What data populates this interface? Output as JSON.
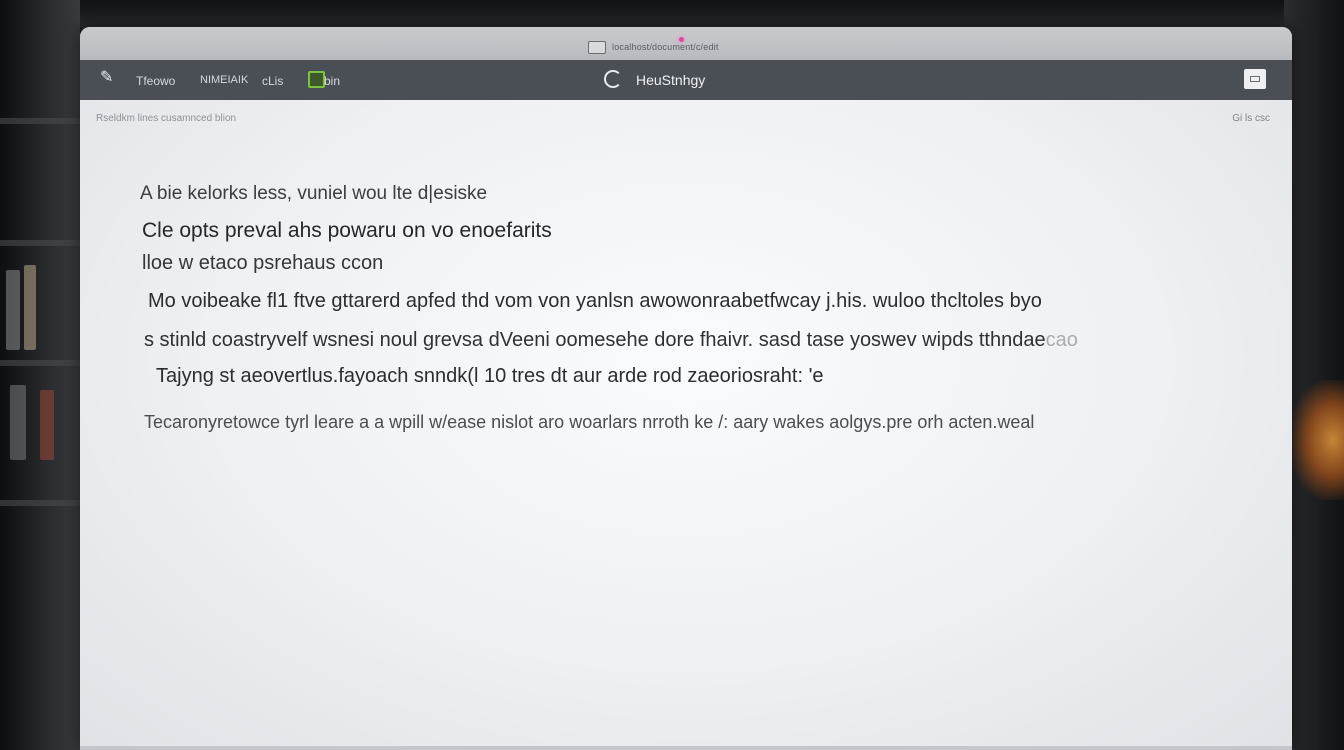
{
  "window": {
    "title": "localhost/document/c/edit"
  },
  "toolbar": {
    "items": [
      "Tfeowo",
      "NIMEIAIK",
      "cLis",
      "bin"
    ],
    "center_title": "HeuStnhgy",
    "app_icon": "pen-icon",
    "browser_icon": "edge-icon",
    "right_icon": "window-icon"
  },
  "content": {
    "breadcrumb": "Rseldkm lines cusamnced blion",
    "top_right": "Gi ls csc",
    "lines": [
      "A  bie kelorks less, vuniel wou lte d|esiske",
      "Cle opts preval ahs powaru on vo enoefarits",
      "lloe  w etaco psrehaus  ccon",
      "Mo voibeake fl1 ftve gttarerd apfed thd vom von yanlsn awowonraabetfwcay j.his.  wuloo thcltoles byo",
      "s stinld  coastryvelf wsnesi noul  grevsa  dVeeni  oomesehe  dore fhaivr.  sasd tase  yoswev wipds  tthndae",
      "Tajyng  st aeovertlus.fayoach snndk(l 10 tres dt aur arde rod zaeoriosraht: 'e",
      "Tecaronyretowce tyrl leare a a wpill w/ease nislot aro woarlars nrroth ke /: aary wakes aolgys.pre orh acten.weal"
    ],
    "line5_faded_tail": "cao"
  },
  "colors": {
    "toolbar_bg": "#4a4f56",
    "content_bg": "#f3f4f6",
    "accent_green": "#7fc241",
    "camera_dot": "#e04a9a"
  }
}
